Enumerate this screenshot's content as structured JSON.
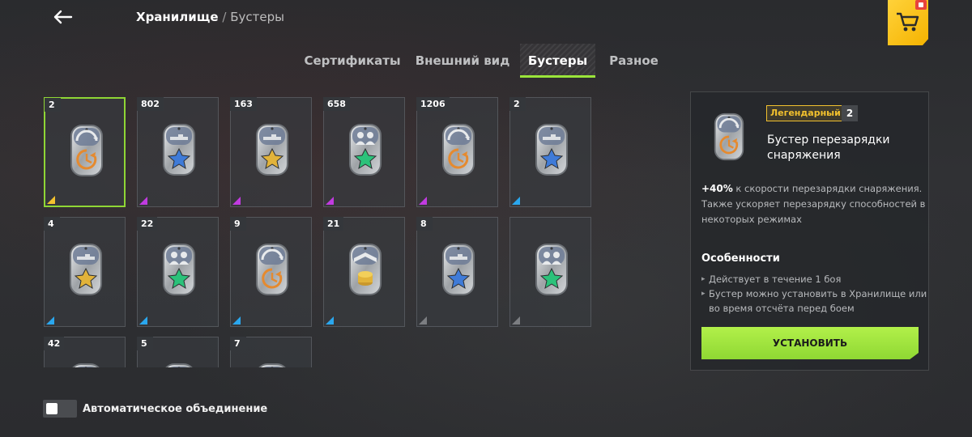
{
  "header": {
    "breadcrumb_main": "Хранилище",
    "breadcrumb_sep": "/",
    "breadcrumb_sub": "Бустеры"
  },
  "tabs": [
    {
      "label": "Сертификаты",
      "active": false
    },
    {
      "label": "Внешний вид",
      "active": false
    },
    {
      "label": "Бустеры",
      "active": true
    },
    {
      "label": "Разное",
      "active": false
    }
  ],
  "rarity_colors": {
    "legendary": "#f2c12e",
    "epic": "#c13be0",
    "rare": "#2aa7ee",
    "common": "#7c7e82"
  },
  "boosters": [
    {
      "count": "2",
      "icon": "reload-booster-icon",
      "star": "none",
      "rarity": "legendary",
      "selected": true
    },
    {
      "count": "802",
      "icon": "tank-star-booster-icon",
      "star": "#3f7bd8",
      "rarity": "epic"
    },
    {
      "count": "163",
      "icon": "tank-star-booster-icon",
      "star": "#e2b33a",
      "rarity": "epic"
    },
    {
      "count": "658",
      "icon": "crew-star-booster-icon",
      "star": "#2bc27a",
      "rarity": "epic"
    },
    {
      "count": "1206",
      "icon": "reload-booster-icon",
      "star": "none",
      "rarity": "epic"
    },
    {
      "count": "2",
      "icon": "tank-star-booster-icon",
      "star": "#3f7bd8",
      "rarity": "rare"
    },
    {
      "count": "4",
      "icon": "tank-star-booster-icon",
      "star": "#e2b33a",
      "rarity": "rare"
    },
    {
      "count": "22",
      "icon": "crew-star-booster-icon",
      "star": "#2bc27a",
      "rarity": "rare"
    },
    {
      "count": "9",
      "icon": "reload-booster-icon",
      "star": "none",
      "rarity": "rare"
    },
    {
      "count": "21",
      "icon": "credits-booster-icon",
      "star": "none",
      "rarity": "rare"
    },
    {
      "count": "8",
      "icon": "tank-star-booster-icon",
      "star": "#3f7bd8",
      "rarity": "common"
    },
    {
      "count": "",
      "icon": "crew-star-booster-icon",
      "star": "#2bc27a",
      "rarity": "common"
    },
    {
      "count": "42",
      "icon": "reload-booster-icon",
      "star": "none",
      "rarity": "common"
    },
    {
      "count": "5",
      "icon": "credits-booster-icon",
      "star": "none",
      "rarity": "common"
    },
    {
      "count": "7",
      "icon": "credits-booster-icon",
      "star": "none",
      "rarity": "common"
    }
  ],
  "toggle": {
    "label": "Автоматическое объединение",
    "on": false
  },
  "detail": {
    "rarity_label": "Легендарный",
    "count": "2",
    "title": "Бустер перезарядки снаряжения",
    "desc_bold": "+40%",
    "desc_rest": " к скорости перезарядки снаряжения. Также ускоряет перезарядку способностей в некоторых режимах",
    "features_title": "Особенности",
    "features": [
      "Действует в течение 1 боя",
      "Бустер можно установить в Хранилище или во время отсчёта перед боем"
    ],
    "install_label": "УСТАНОВИТЬ"
  }
}
